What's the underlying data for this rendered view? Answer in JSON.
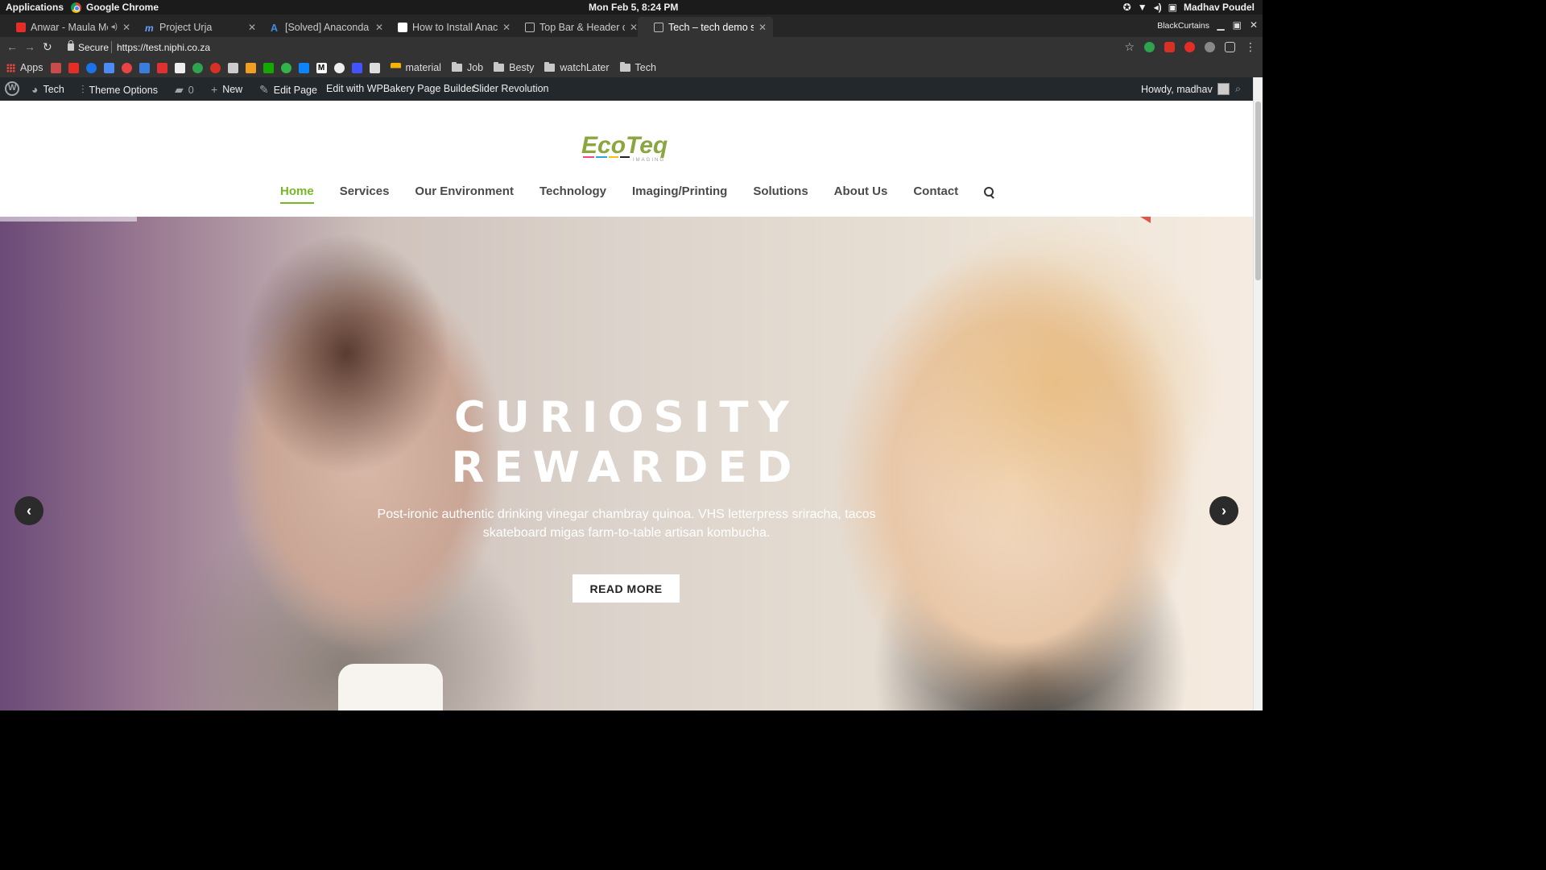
{
  "os": {
    "applications": "Applications",
    "app_name": "Google Chrome",
    "clock": "Mon Feb  5,  8:24 PM",
    "user": "Madhav Poudel"
  },
  "tabs": [
    {
      "title": "Anwar - Maula Me",
      "favicon_color": "#e52d27",
      "audio": "◂)"
    },
    {
      "title": "Project Urja",
      "favicon_color": "#6aa3ff"
    },
    {
      "title": "[Solved] Anaconda i",
      "favicon_color": "#3b8ee8"
    },
    {
      "title": "How to Install Anac",
      "favicon_color": "#ffffff"
    },
    {
      "title": "Top Bar & Header c",
      "favicon_color": "#bbbbbb"
    },
    {
      "title": "Tech – tech demo si",
      "favicon_color": "#bbbbbb"
    }
  ],
  "window": {
    "profile": "BlackCurtains"
  },
  "omnibox": {
    "secure": "Secure",
    "url": "https://test.niphi.co.za"
  },
  "bookmarks": {
    "apps": "Apps",
    "folders": [
      "material",
      "Job",
      "Besty",
      "watchLater",
      "Tech"
    ],
    "icon_colors": [
      "#d33",
      "#e52d27",
      "#1a73e8",
      "#4c8bf5",
      "#e94444",
      "#3b7ddd",
      "#e03030",
      "#eeeeee",
      "#2ea44f",
      "#d93025",
      "#cccccc",
      "#f0a020",
      "#14a800",
      "#31b54b",
      "#0b84ff",
      "#ffffff",
      "#eeeeee",
      "#4353ff",
      "#dddddd"
    ]
  },
  "wpbar": {
    "site": "Tech",
    "theme_options": "Theme Options",
    "comments": "0",
    "new": "New",
    "edit_page": "Edit Page",
    "wpbakery": "Edit with WPBakery Page Builder",
    "slider": "Slider Revolution",
    "howdy": "Howdy, madhav"
  },
  "site": {
    "logo_text": "EcoTeq",
    "logo_sub": "IMAGING",
    "accent": "#76b729",
    "menu": [
      "Home",
      "Services",
      "Our Environment",
      "Technology",
      "Imaging/Printing",
      "Solutions",
      "About Us",
      "Contact"
    ]
  },
  "hero": {
    "title_line1": "CURIOSITY",
    "title_line2": "REWARDED",
    "subtitle": "Post-ironic authentic drinking vinegar chambray quinoa. VHS letterpress sriracha, tacos skateboard migas farm-to-table artisan kombucha.",
    "button": "READ MORE"
  }
}
